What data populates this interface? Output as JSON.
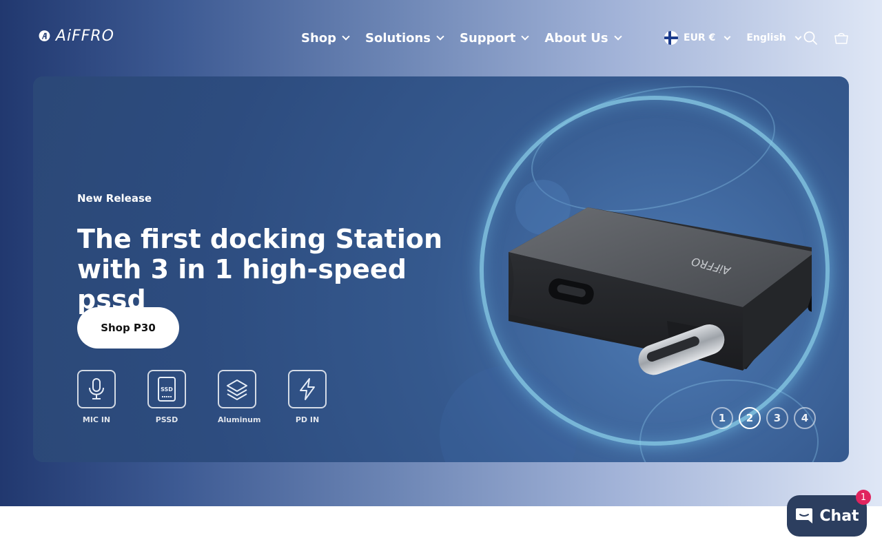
{
  "header": {
    "logo_text": "AiFFRO",
    "nav": [
      {
        "label": "Shop"
      },
      {
        "label": "Solutions"
      },
      {
        "label": "Support"
      },
      {
        "label": "About Us"
      }
    ],
    "currency": "EUR €",
    "language": "English",
    "icons": {
      "search": "search-icon",
      "cart": "cart-icon",
      "flag": "finland-flag-icon"
    }
  },
  "hero": {
    "eyebrow": "New Release",
    "headline": "The first docking Station with 3 in 1 high-speed pssd",
    "cta_label": "Shop P30",
    "features": [
      {
        "icon": "microphone-icon",
        "label": "MIC IN"
      },
      {
        "icon": "ssd-icon",
        "label": "PSSD"
      },
      {
        "icon": "layers-icon",
        "label": "Aluminum"
      },
      {
        "icon": "lightning-icon",
        "label": "PD IN"
      }
    ],
    "device_logo_text": "AiFFRO",
    "ssd_icon_text": "SSD",
    "slides": [
      "1",
      "2",
      "3",
      "4"
    ],
    "active_slide": "2"
  },
  "chat": {
    "label": "Chat",
    "badge": "1"
  },
  "colors": {
    "chat_bg": "#2c3e5f",
    "badge": "#e0245e",
    "ring": "#8cd2eb"
  }
}
